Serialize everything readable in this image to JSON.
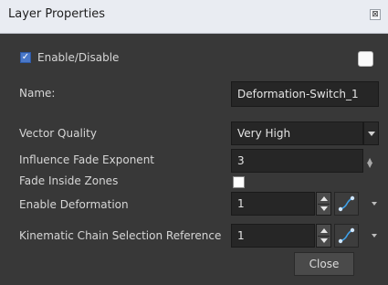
{
  "window": {
    "title": "Layer Properties",
    "close_glyph": "⊠"
  },
  "enable": {
    "label": "Enable/Disable",
    "checked": true,
    "check_glyph": "✓"
  },
  "name": {
    "label": "Name:",
    "value": "Deformation-Switch_1"
  },
  "vector_quality": {
    "label": "Vector Quality",
    "value": "Very High"
  },
  "influence_fade": {
    "label": "Influence Fade Exponent",
    "value": "3"
  },
  "fade_inside": {
    "label": "Fade Inside Zones",
    "checked": false
  },
  "enable_deformation": {
    "label": "Enable Deformation",
    "value": "1"
  },
  "kinematic": {
    "label": "Kinematic Chain Selection Reference",
    "value": "1"
  },
  "buttons": {
    "close_label": "Close"
  },
  "colors": {
    "accent": "#4a78c8",
    "curve_icon": "#3fa0e8"
  }
}
